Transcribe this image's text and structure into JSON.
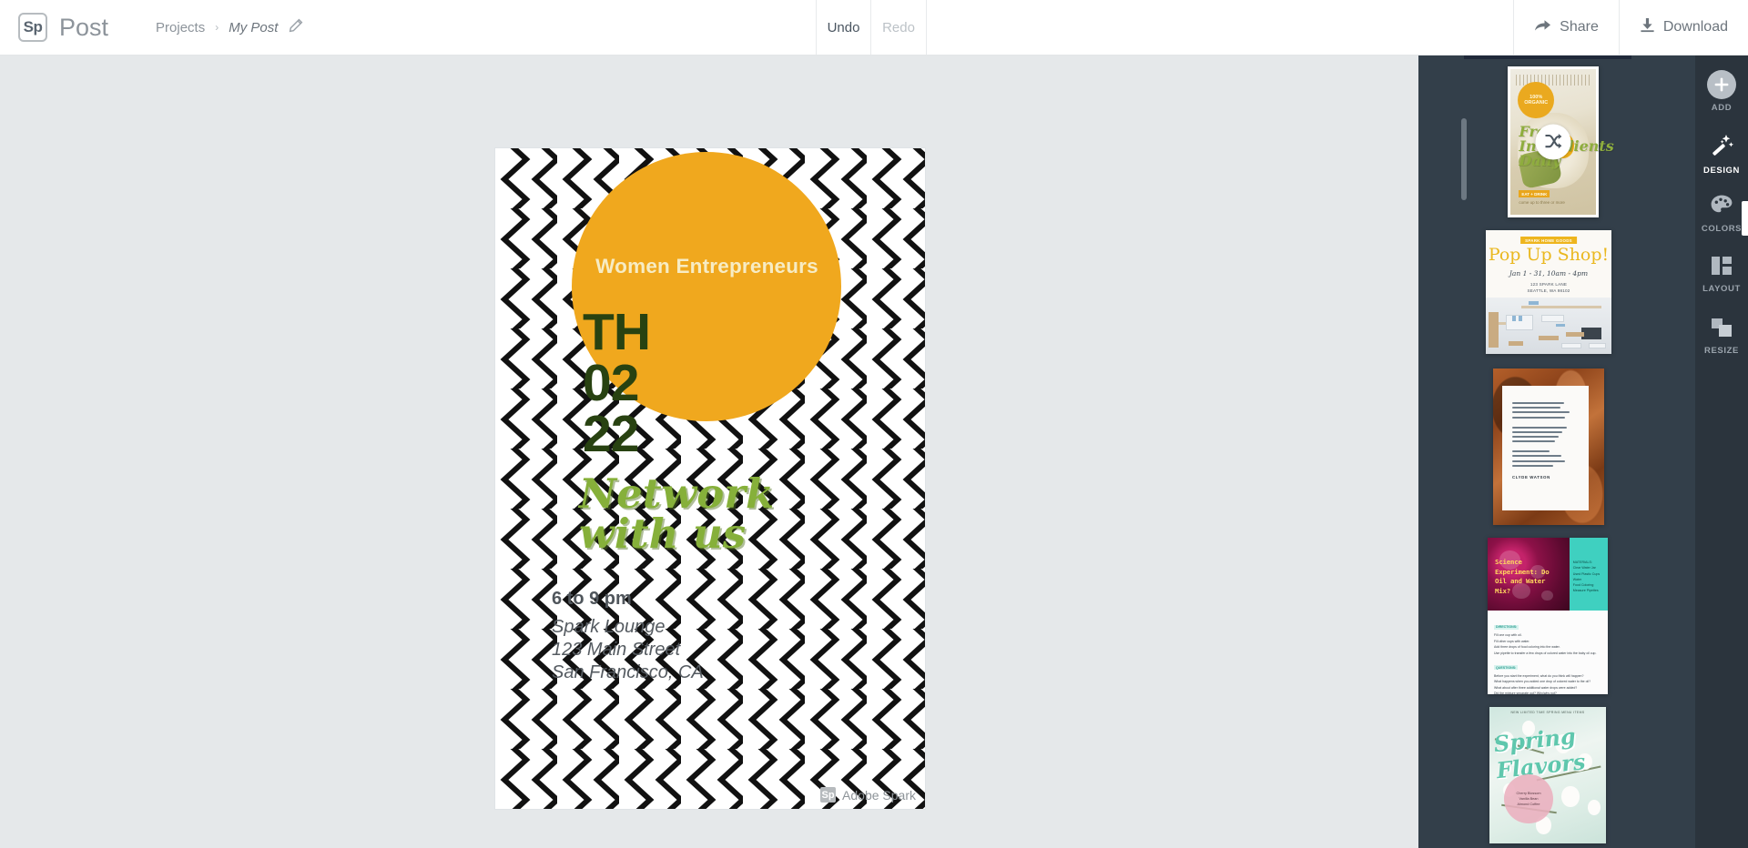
{
  "app": {
    "logo_text": "Sp",
    "name": "Post"
  },
  "breadcrumb": {
    "root": "Projects",
    "separator": "›",
    "current": "My Post",
    "edit_icon": "pencil-icon"
  },
  "history": {
    "undo_label": "Undo",
    "undo_enabled": "true",
    "redo_label": "Redo",
    "redo_enabled": "false"
  },
  "topbar_actions": [
    {
      "label": "Share",
      "icon": "share-arrow-icon"
    },
    {
      "label": "Download",
      "icon": "download-arrow-icon"
    }
  ],
  "poster": {
    "badge_title": "Women Entrepreneurs",
    "date_lines": [
      "TH",
      "02",
      "22"
    ],
    "script_text": "Network with us",
    "time": "6 to 9 pm",
    "venue": "Spark Lounge",
    "street": "123 Main Street",
    "city": "San Francisco, CA",
    "watermark_badge": "Sp",
    "watermark_text": "Adobe Spark",
    "colors": {
      "circle": "#F0A81E",
      "badge_text": "#F7ECC4",
      "date_text": "#284211",
      "script_text": "#86B03A",
      "pattern": "#111111",
      "paper": "#FFFFFF"
    }
  },
  "workspace": {
    "background_color": "#E5E8EA",
    "panel_color": "#333F4A",
    "rail_color": "#2B343D"
  },
  "design_panel": {
    "thumbnails": [
      {
        "name": "fresh-ingredients-food-post",
        "selected": "true",
        "overlay_icon": "shuffle-icon",
        "badge": "100% ORGANIC",
        "headline": "Fresh Ingredients Daily",
        "footer_pill": "EAT + DRINK",
        "footer_sub": "come up to three or more"
      },
      {
        "name": "pop-up-shop-post",
        "selected": "false",
        "badge": "SPARK HOME GOODS",
        "title": "Pop Up Shop!",
        "date": "Jan 1 - 31, 10am - 4pm",
        "address_line1": "123 SPARK LANE",
        "address_line2": "SEATTLE, WA 98102"
      },
      {
        "name": "november-poem-post",
        "selected": "false",
        "author": "CLYDE WATSON",
        "stanza_line_counts": [
          4,
          4,
          4
        ]
      },
      {
        "name": "science-experiment-post",
        "selected": "false",
        "heading": "Science Experiment: Do Oil and Water Mix?",
        "materials_label": "MATERIALS:",
        "materials": [
          "Clear Water Jar",
          "Used Plastic Cups",
          "Water",
          "Food Coloring",
          "Measure Pipettes"
        ],
        "directions_label": "DIRECTIONS:",
        "directions": [
          "Fill one cup with oil.",
          "Fill other cups with water.",
          "Add three drops of food coloring into the water.",
          "Use pipette to transfer a few drops of colored water into the baby oil cup."
        ],
        "questions_label": "QUESTIONS:",
        "questions": [
          "Before you start the experiment, what do you think will happen?",
          "What happens when you added one drop of colored water to the oil?",
          "What about after three additional water drops were added?",
          "Did the mixture separate out? Why/why not?"
        ]
      },
      {
        "name": "spring-flavors-post",
        "selected": "false",
        "eyebrow": "NEW LIMITED TIME SPRING MENU ITEMS",
        "title": "Spring Flavors",
        "circle_items": [
          "Cherry Blossom",
          "Vanilla Bean",
          "Almond Coffee"
        ]
      }
    ]
  },
  "tool_rail": [
    {
      "label": "ADD",
      "icon": "plus-circle-icon",
      "active": "false"
    },
    {
      "label": "DESIGN",
      "icon": "magic-wand-icon",
      "active": "true"
    },
    {
      "label": "COLORS",
      "icon": "palette-icon",
      "active": "false"
    },
    {
      "label": "LAYOUT",
      "icon": "layout-grid-icon",
      "active": "false"
    },
    {
      "label": "RESIZE",
      "icon": "resize-icon",
      "active": "false"
    }
  ]
}
